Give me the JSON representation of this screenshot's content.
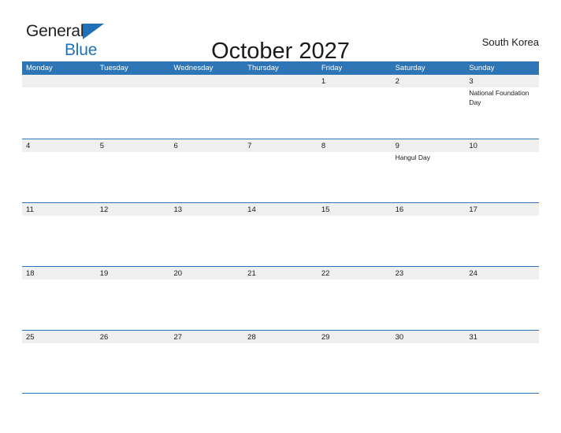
{
  "brand": {
    "word_dark": "General",
    "word_blue": "Blue",
    "triangle_color": "#1f72b8"
  },
  "header": {
    "title": "October 2027",
    "locale": "South Korea"
  },
  "colors": {
    "header_blue": "#2e75b6",
    "date_band_gray": "#efefef",
    "page_background": "#ffffff",
    "text": "#1a1a1a"
  },
  "calendar": {
    "weekdays": [
      "Monday",
      "Tuesday",
      "Wednesday",
      "Thursday",
      "Friday",
      "Saturday",
      "Sunday"
    ],
    "weeks": [
      [
        {
          "date": "",
          "events": []
        },
        {
          "date": "",
          "events": []
        },
        {
          "date": "",
          "events": []
        },
        {
          "date": "",
          "events": []
        },
        {
          "date": "1",
          "events": []
        },
        {
          "date": "2",
          "events": []
        },
        {
          "date": "3",
          "events": [
            "National Foundation Day"
          ]
        }
      ],
      [
        {
          "date": "4",
          "events": []
        },
        {
          "date": "5",
          "events": []
        },
        {
          "date": "6",
          "events": []
        },
        {
          "date": "7",
          "events": []
        },
        {
          "date": "8",
          "events": []
        },
        {
          "date": "9",
          "events": [
            "Hangul Day"
          ]
        },
        {
          "date": "10",
          "events": []
        }
      ],
      [
        {
          "date": "11",
          "events": []
        },
        {
          "date": "12",
          "events": []
        },
        {
          "date": "13",
          "events": []
        },
        {
          "date": "14",
          "events": []
        },
        {
          "date": "15",
          "events": []
        },
        {
          "date": "16",
          "events": []
        },
        {
          "date": "17",
          "events": []
        }
      ],
      [
        {
          "date": "18",
          "events": []
        },
        {
          "date": "19",
          "events": []
        },
        {
          "date": "20",
          "events": []
        },
        {
          "date": "21",
          "events": []
        },
        {
          "date": "22",
          "events": []
        },
        {
          "date": "23",
          "events": []
        },
        {
          "date": "24",
          "events": []
        }
      ],
      [
        {
          "date": "25",
          "events": []
        },
        {
          "date": "26",
          "events": []
        },
        {
          "date": "27",
          "events": []
        },
        {
          "date": "28",
          "events": []
        },
        {
          "date": "29",
          "events": []
        },
        {
          "date": "30",
          "events": []
        },
        {
          "date": "31",
          "events": []
        }
      ]
    ]
  }
}
